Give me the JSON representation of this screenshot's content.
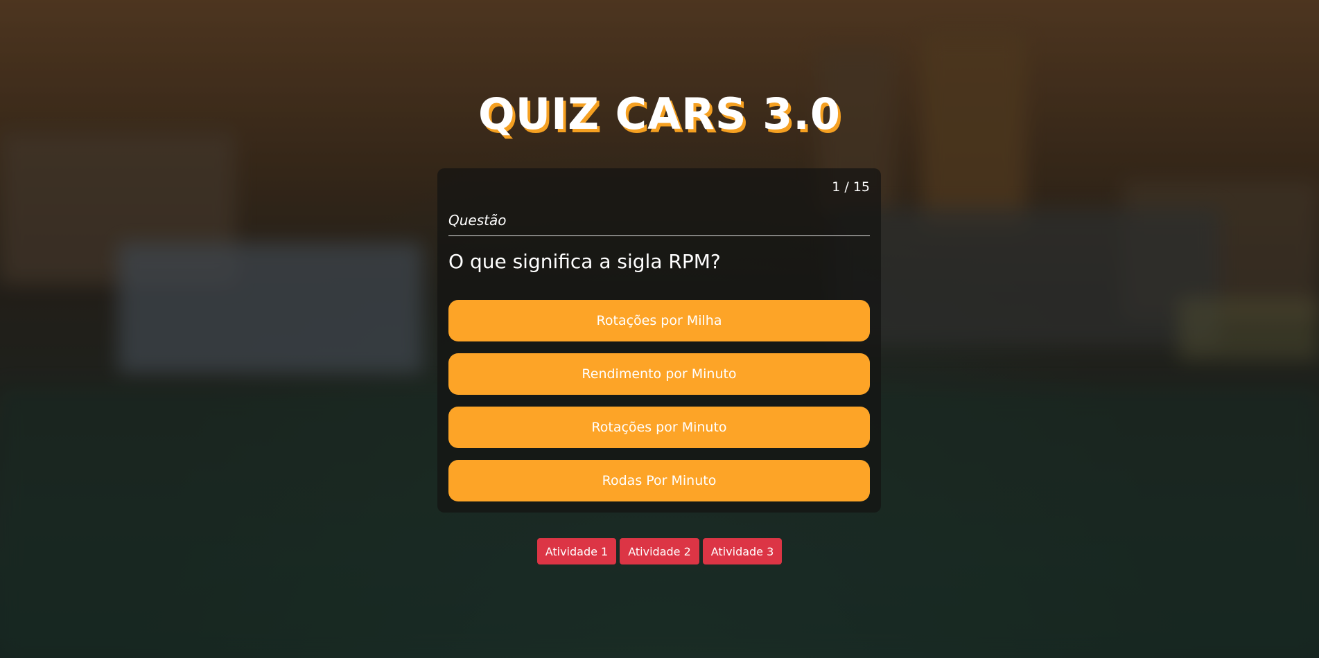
{
  "page": {
    "title": "QUIZ CARS 3.0"
  },
  "quiz": {
    "counter": "1 / 15",
    "section_label": "Questão",
    "question": "O que significa a sigla RPM?",
    "answers": [
      "Rotações por Milha",
      "Rendimento por Minuto",
      "Rotações por Minuto",
      "Rodas Por Minuto"
    ]
  },
  "activities": [
    "Atividade 1",
    "Atividade 2",
    "Atividade 3"
  ],
  "colors": {
    "accent": "#fda427",
    "title_shadow": "#f5a021",
    "activity_button": "#dc3545",
    "card_background": "rgba(20,20,18,0.72)"
  }
}
